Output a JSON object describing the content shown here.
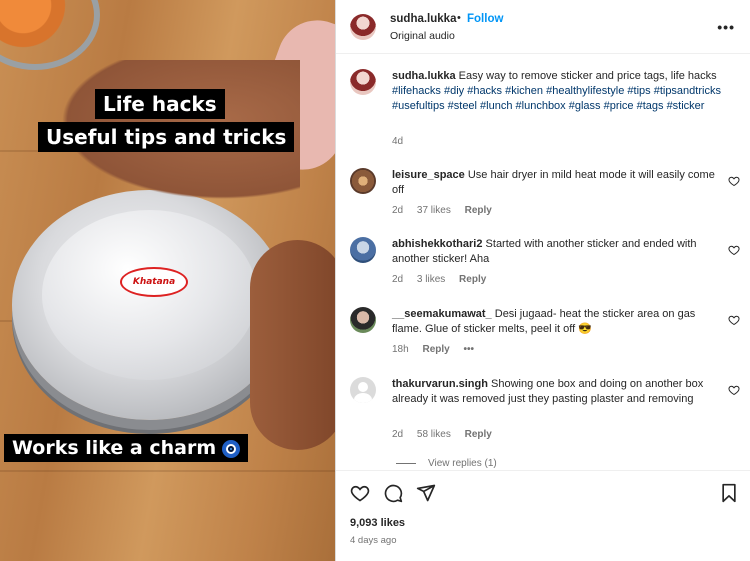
{
  "media": {
    "overlay_line1": "Life hacks",
    "overlay_line2": "Useful tips and tricks",
    "overlay_line3": "Works like a charm",
    "sticker_text": "Khatana"
  },
  "header": {
    "username": "sudha.lukka",
    "separator": "•",
    "follow_label": "Follow",
    "audio": "Original audio",
    "more_icon": "more-horizontal-icon"
  },
  "caption": {
    "username": "sudha.lukka",
    "text": "Easy way to remove sticker and price tags, life hacks",
    "hashtags": "#lifehacks #diy #hacks #kichen #healthylifestyle #tips #tipsandtricks #usefultips #steel #lunch #lunchbox #glass #price #tags #sticker",
    "age": "4d"
  },
  "comments": [
    {
      "username": "leisure_space",
      "text": "Use hair dryer in mild heat mode it will easily come off",
      "age": "2d",
      "likes": "37 likes",
      "reply": "Reply"
    },
    {
      "username": "abhishekkothari2",
      "text": "Started with another sticker and ended with another sticker! Aha",
      "age": "2d",
      "likes": "3 likes",
      "reply": "Reply"
    },
    {
      "username": "__seemakumawat_",
      "text": "Desi jugaad- heat the sticker area on gas flame. Glue of sticker melts, peel it off 😎",
      "age": "18h",
      "likes": "",
      "reply": "Reply",
      "more": "•••"
    },
    {
      "username": "thakurvarun.singh",
      "text": "Showing one box and doing on another box already it was removed just they pasting plaster and removing",
      "age": "2d",
      "likes": "58 likes",
      "reply": "Reply"
    }
  ],
  "view_replies": "View replies (1)",
  "footer": {
    "likes": "9,093 likes",
    "post_age": "4 days ago",
    "icons": [
      "heart-icon",
      "comment-icon",
      "share-icon",
      "bookmark-icon"
    ]
  },
  "colors": {
    "link": "#0095f6",
    "hashtag": "#00376b",
    "muted": "#737373"
  }
}
